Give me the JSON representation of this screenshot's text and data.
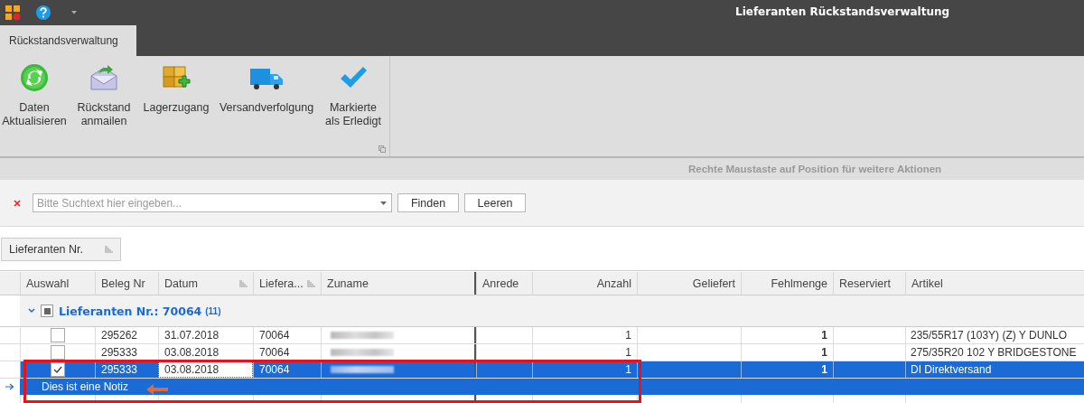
{
  "window": {
    "title": "Lieferanten Rückstandsverwaltung"
  },
  "tabs": [
    {
      "label": "Rückstandsverwaltung",
      "selected": true
    }
  ],
  "ribbon": {
    "buttons": [
      {
        "kind": "refresh",
        "lines": [
          "Daten",
          "Aktualisieren"
        ]
      },
      {
        "kind": "mail",
        "lines": [
          "Rückstand",
          "anmailen"
        ]
      },
      {
        "kind": "stock",
        "lines": [
          "Lagerzugang"
        ]
      },
      {
        "kind": "truck",
        "lines": [
          "Versandverfolgung"
        ]
      },
      {
        "kind": "check",
        "lines": [
          "Markierte",
          "als Erledigt"
        ]
      }
    ]
  },
  "hint": "Rechte Maustaste auf Position für weitere Aktionen",
  "search": {
    "placeholder": "Bitte Suchtext hier eingeben...",
    "buttons": [
      "Finden",
      "Leeren"
    ]
  },
  "group_panel": {
    "chips": [
      "Lieferanten Nr."
    ]
  },
  "table": {
    "columns": [
      {
        "label": "Auswahl",
        "kind": "check",
        "filter": false
      },
      {
        "label": "Beleg Nr",
        "kind": "text",
        "filter": false
      },
      {
        "label": "Datum",
        "kind": "text",
        "filter": true
      },
      {
        "label": "Liefera...",
        "kind": "text",
        "filter": true
      },
      {
        "label": "Zuname",
        "kind": "redacted",
        "filter": false
      },
      {
        "label": "Anrede",
        "kind": "text",
        "filter": false
      },
      {
        "label": "Anzahl",
        "kind": "number",
        "filter": false
      },
      {
        "label": "Geliefert",
        "kind": "number",
        "filter": false
      },
      {
        "label": "Fehlmenge",
        "kind": "bold_number",
        "filter": false
      },
      {
        "label": "Reserviert",
        "kind": "text",
        "filter": false
      },
      {
        "label": "Artikel",
        "kind": "text",
        "filter": false
      }
    ],
    "group": {
      "label": "Lieferanten Nr.: 70064",
      "count": "(11)",
      "expanded": true,
      "indeterminate": true
    },
    "rows": [
      {
        "checked": false,
        "selected": false,
        "current": false,
        "cells": [
          null,
          {
            "text": "295262",
            "focused": false
          },
          {
            "text": "31.07.2018",
            "focused": false
          },
          {
            "text": "70064",
            "focused": false
          },
          null,
          null,
          {
            "text": "1",
            "focused": false
          },
          null,
          {
            "text": "1",
            "focused": false
          },
          null,
          {
            "text": "235/55R17 (103Y) (Z) Y DUNLO",
            "focused": false
          }
        ]
      },
      {
        "checked": false,
        "selected": false,
        "current": false,
        "cells": [
          null,
          {
            "text": "295333",
            "focused": false
          },
          {
            "text": "03.08.2018",
            "focused": false
          },
          {
            "text": "70064",
            "focused": false
          },
          null,
          null,
          {
            "text": "1",
            "focused": false
          },
          null,
          {
            "text": "1",
            "focused": false
          },
          null,
          {
            "text": "275/35R20 102 Y BRIDGESTONE",
            "focused": false
          }
        ]
      },
      {
        "checked": true,
        "selected": true,
        "current": true,
        "note": "Dies ist eine Notiz",
        "cells": [
          null,
          {
            "text": "295333",
            "focused": false
          },
          {
            "text": "03.08.2018",
            "focused": true
          },
          {
            "text": "70064",
            "focused": false
          },
          null,
          null,
          {
            "text": "1",
            "focused": false
          },
          null,
          {
            "text": "1",
            "focused": false
          },
          null,
          {
            "text": "DI Direktversand",
            "focused": false
          }
        ]
      }
    ]
  }
}
